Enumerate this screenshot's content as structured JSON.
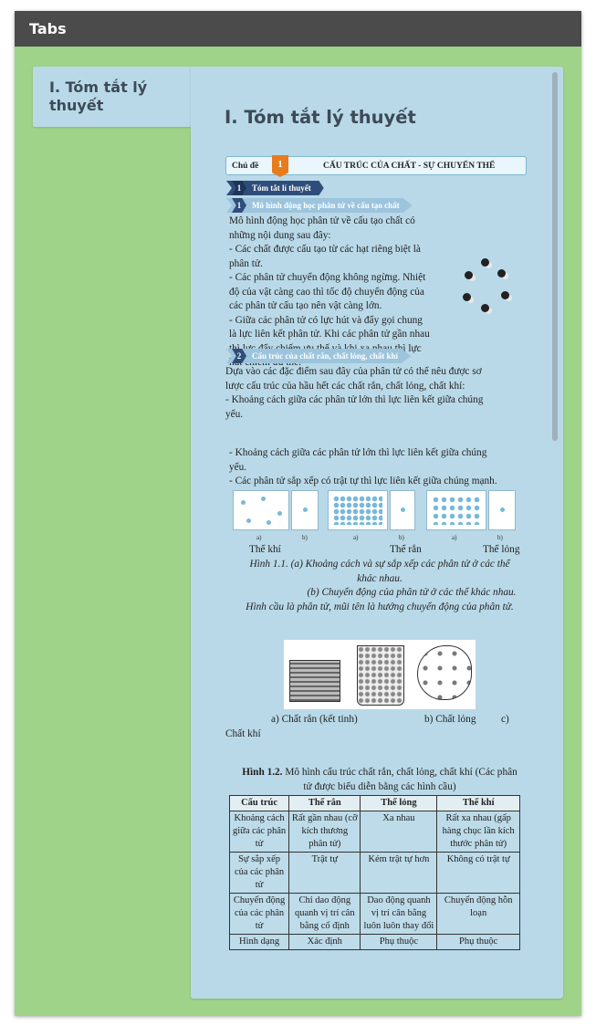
{
  "window": {
    "title": "Tabs"
  },
  "tab": {
    "label": "I. Tóm tắt lý thuyết"
  },
  "panel": {
    "title": "I. Tóm tắt lý thuyết"
  },
  "doc": {
    "topic_label": "Chủ đề",
    "topic_num": "1",
    "topic_title": "CẤU TRÚC CỦA CHẤT - SỰ CHUYỂN THỂ",
    "section_main": {
      "num": "1",
      "label": "Tóm tắt lí thuyết"
    },
    "sub1": {
      "num": "1",
      "label": "Mô hình động học phân tử về cấu tạo chất"
    },
    "sub1_lines": [
      "Mô hình động học phân tử về cấu tạo chất có",
      "những nội dung sau đây:",
      "- Các chất được cấu tạo từ các hạt riêng biệt là",
      "phân tử.",
      "- Các phân tử chuyển động không ngừng. Nhiệt",
      "độ của vật càng cao thì tốc độ chuyển động của",
      "các phân tử cấu tạo nên vật càng lớn.",
      "- Giữa các phân tử có lực hút và đẩy gọi chung",
      "là lực liên kết phân tử. Khi các phân tử gần nhau",
      "thì lực đẩy chiếm ưu thế và khi xa nhau thì lực",
      "hút chiếm ưu thế."
    ],
    "sub2": {
      "num": "2",
      "label": "Cấu trúc của chất rắn, chất lỏng, chất khí"
    },
    "sub2_lines": [
      "Dựa vào các đặc điểm sau đây của phân tử có thể nêu được sơ",
      "lược cấu trúc của hầu hết các chất rắn, chất lỏng, chất khí:",
      "- Khoảng cách giữa các phân tử lớn thì lực liên kết giữa chúng",
      "yếu."
    ],
    "repeat_lines": [
      "- Khoảng cách giữa các phân tử lớn thì lực liên kết giữa chúng",
      "yếu.",
      "- Các phân tử sắp xếp có trật tự thì lực liên kết giữa chúng mạnh."
    ],
    "sublabel_a": "a)",
    "sublabel_b": "b)",
    "state_gas": "Thể khí",
    "state_solid": "Thể rắn",
    "state_liquid": "Thể lỏng",
    "fig11_caption_1": "Hình 1.1. (a) Khoảng cách và sự sắp xếp các phân tử ở các thể",
    "fig11_caption_2": "khác nhau.",
    "fig11_caption_3": "(b) Chuyển động của phân tử ở các thể khác nhau.",
    "fig11_caption_4": "Hình cầu là phân tử, mũi tên là hướng chuyển động của phân tử.",
    "img_label_a": "a) Chất rắn (kết tinh)",
    "img_label_b": "b) Chất lỏng",
    "img_label_c": "c)",
    "img_label_c2": "Chất khí",
    "fig12_bold": "Hình 1.2.",
    "fig12_text": "Mô hình cấu trúc chất rắn, chất lỏng, chất khí (Các phân",
    "fig12_text2": "tử được biểu diễn bằng các hình cầu)",
    "table": {
      "headers": [
        "Cấu trúc",
        "Thể rắn",
        "Thể lỏng",
        "Thể khí"
      ],
      "rows": [
        [
          "Khoảng cách giữa các phân tử",
          "Rất gần nhau (cỡ kích thương phân tử)",
          "Xa nhau",
          "Rất xa nhau (gấp hàng chục lần kích thước phân tử)"
        ],
        [
          "Sự sắp xếp của các phân tử",
          "Trật tự",
          "Kém trật tự hơn",
          "Không có trật tự"
        ],
        [
          "Chuyển động của các phân tử",
          "Chỉ dao động quanh vị trí cân bằng cố định",
          "Dao động quanh vị trí cân bằng luôn luôn thay đổi",
          "Chuyển động hỗn loạn"
        ],
        [
          "Hình dạng",
          "Xác định",
          "Phụ thuộc",
          "Phụ thuộc"
        ]
      ]
    }
  }
}
